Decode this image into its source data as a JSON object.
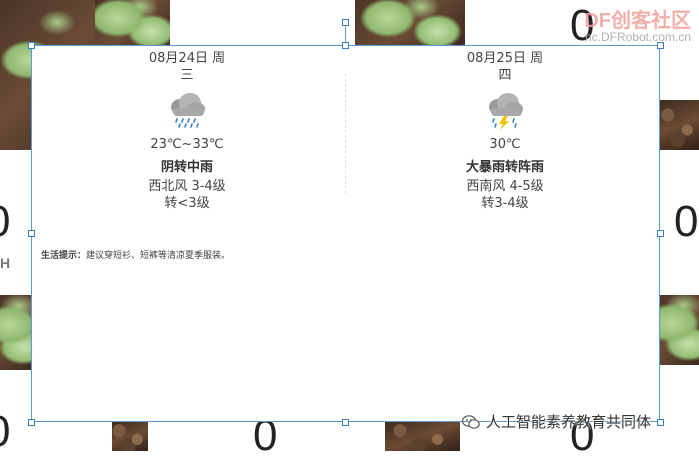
{
  "watermark": {
    "logo": "DF创客社区",
    "url": "nc.DFRobot.com.cn"
  },
  "background": {
    "digits": [
      "0",
      "0",
      "0",
      "0",
      "0",
      "0"
    ],
    "side_letter": "H"
  },
  "weather": {
    "days": [
      {
        "date": "08月24日 周",
        "weekday": "三",
        "icon": "overcast-rain-icon",
        "temp": "23℃~33℃",
        "condition": "阴转中雨",
        "wind": "西北风 3-4级",
        "wind_change": "转<3级"
      },
      {
        "date": "08月25日 周",
        "weekday": "四",
        "icon": "thunderstorm-icon",
        "temp": "30℃",
        "condition": "大暴雨转阵雨",
        "wind": "西南风 4-5级",
        "wind_change": "转3-4级"
      }
    ],
    "tip_label": "生活提示：",
    "tip_text": "建议穿短衫、短裤等清凉夏季服装。"
  },
  "footer": {
    "wechat_account": "人工智能素养教育共同体"
  },
  "colors": {
    "selection": "#5b9bd5",
    "logo": "#f0a09a"
  }
}
